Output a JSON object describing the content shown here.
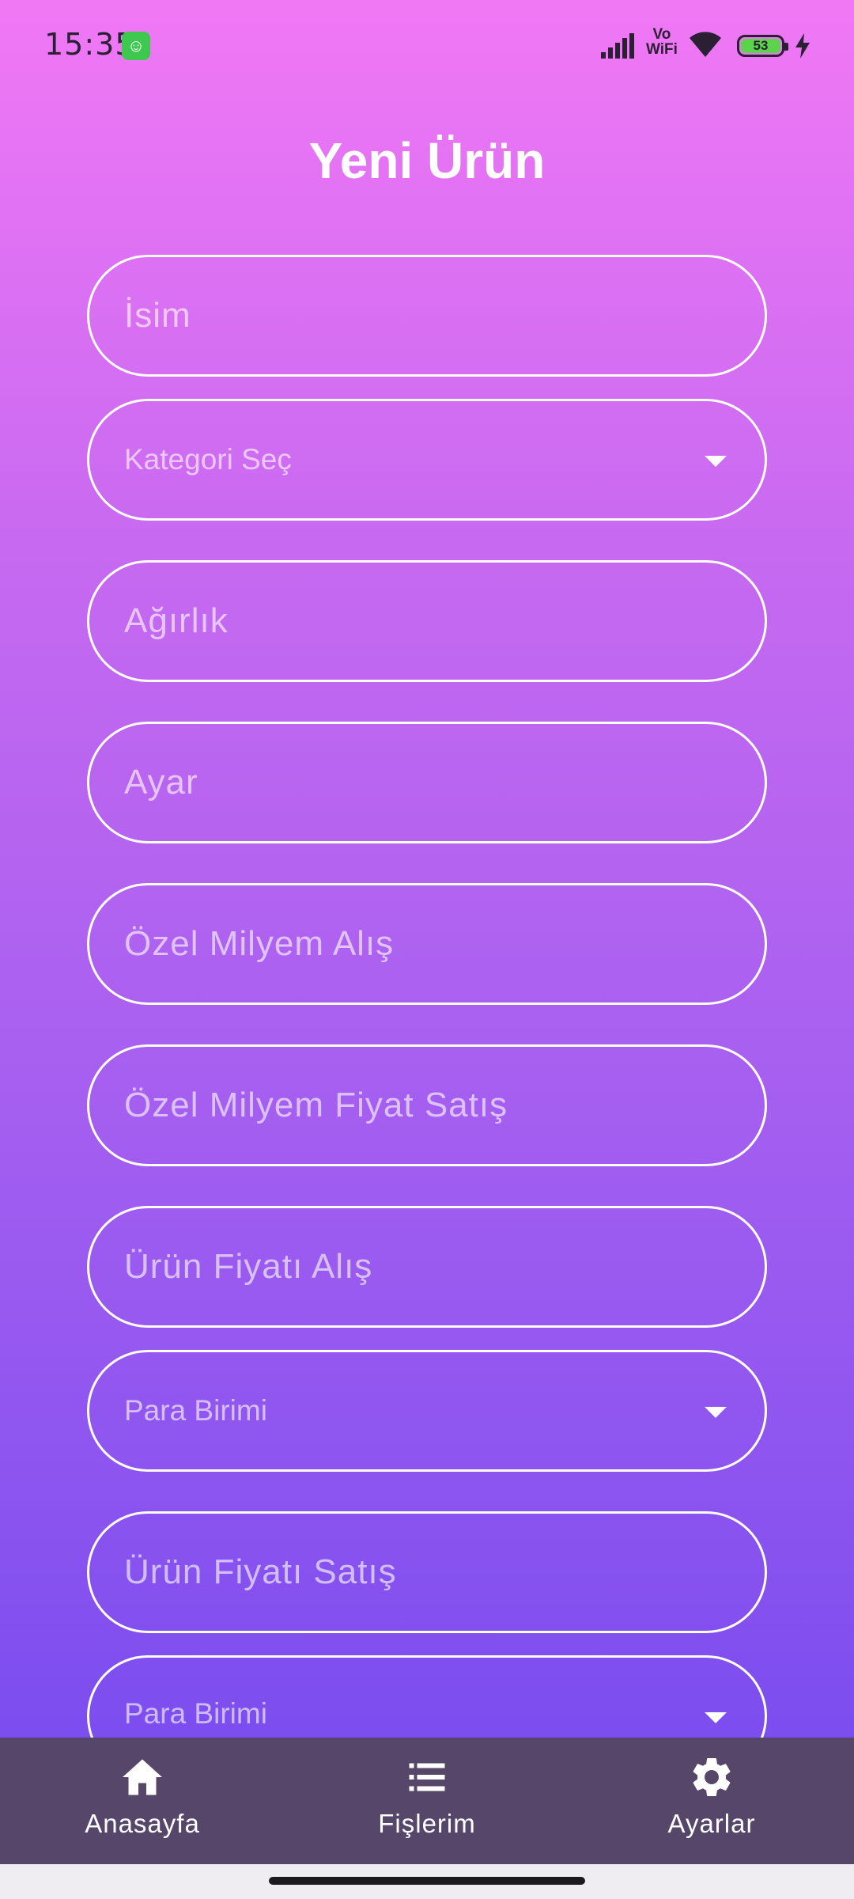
{
  "status_bar": {
    "time": "15:35",
    "vo_top": "Vo",
    "vo_bottom": "WiFi",
    "battery": "53"
  },
  "page": {
    "title": "Yeni Ürün"
  },
  "form": {
    "name": "İsim",
    "category": "Kategori Seç",
    "weight": "Ağırlık",
    "ayar": "Ayar",
    "special_buy": "Özel Milyem Alış",
    "special_sell": "Özel Milyem Fiyat Satış",
    "price_buy": "Ürün Fiyatı Alış",
    "currency_1": "Para Birimi",
    "price_sell": "Ürün Fiyatı Satış",
    "currency_2": "Para Birimi"
  },
  "nav": {
    "home": "Anasayfa",
    "receipts": "Fişlerim",
    "settings": "Ayarlar"
  },
  "colors": {
    "gradient_top": "#f178f5",
    "gradient_bottom": "#7c4def",
    "nav_bg": "#56476a"
  }
}
